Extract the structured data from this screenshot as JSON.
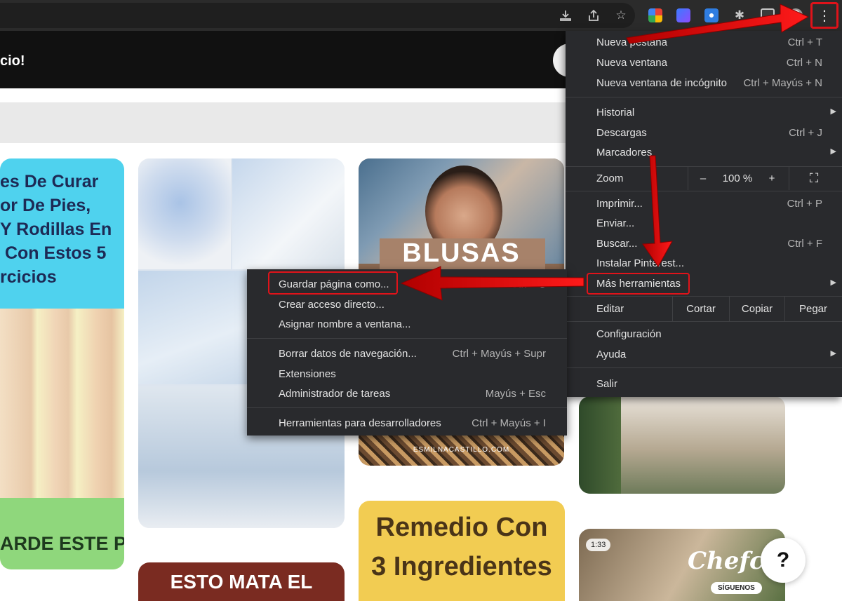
{
  "page": {
    "banner_text": "cio!",
    "pins": {
      "legs": {
        "title": "es De Curar\nor De Pies,\nY Rodillas En\n Con Estos 5\nrcicios",
        "cta": "ARDE ESTE PIN"
      },
      "fashion": {
        "title": "BLUSAS",
        "url": "ESMILNACASTILLO.COM"
      },
      "sugar": {
        "title": "ESTO MATA EL"
      },
      "remedy": {
        "title": "Remedio Con\n3 Ingredientes"
      },
      "video": {
        "duration": "1:33",
        "brand": "Chefcl",
        "subscribe": "SÍGUENOS"
      }
    },
    "help_label": "?"
  },
  "toolbar": {
    "icons": [
      "download-icon",
      "share-icon",
      "bookmark-star-icon",
      "puzzle-extensions-icon",
      "profile-avatar"
    ],
    "menu_glyph": "⋮"
  },
  "menu": {
    "nueva_pestana": {
      "label": "Nueva pestaña",
      "shortcut": "Ctrl + T"
    },
    "nueva_ventana": {
      "label": "Nueva ventana",
      "shortcut": "Ctrl + N"
    },
    "incognito": {
      "label": "Nueva ventana de incógnito",
      "shortcut": "Ctrl + Mayús + N"
    },
    "historial": {
      "label": "Historial"
    },
    "descargas": {
      "label": "Descargas",
      "shortcut": "Ctrl + J"
    },
    "marcadores": {
      "label": "Marcadores"
    },
    "zoom": {
      "label": "Zoom",
      "minus": "–",
      "value": "100 %",
      "plus": "+",
      "fullscreen": "⛶"
    },
    "imprimir": {
      "label": "Imprimir...",
      "shortcut": "Ctrl + P"
    },
    "enviar": {
      "label": "Enviar..."
    },
    "buscar": {
      "label": "Buscar...",
      "shortcut": "Ctrl + F"
    },
    "instalar": {
      "label": "Instalar Pinterest..."
    },
    "mas_herramientas": {
      "label": "Más herramientas"
    },
    "editar": {
      "label": "Editar",
      "cortar": "Cortar",
      "copiar": "Copiar",
      "pegar": "Pegar"
    },
    "configuracion": {
      "label": "Configuración"
    },
    "ayuda": {
      "label": "Ayuda"
    },
    "salir": {
      "label": "Salir"
    }
  },
  "submenu": {
    "guardar": {
      "label": "Guardar página como...",
      "shortcut": "Ctrl + S"
    },
    "acceso": {
      "label": "Crear acceso directo..."
    },
    "asignar": {
      "label": "Asignar nombre a ventana..."
    },
    "borrar": {
      "label": "Borrar datos de navegación...",
      "shortcut": "Ctrl + Mayús + Supr"
    },
    "extensiones": {
      "label": "Extensiones"
    },
    "tareas": {
      "label": "Administrador de tareas",
      "shortcut": "Mayús + Esc"
    },
    "devtools": {
      "label": "Herramientas para desarrolladores",
      "shortcut": "Ctrl + Mayús + I"
    }
  },
  "colors": {
    "toolbar": "#2b2b2b",
    "menu_bg": "#292a2d",
    "highlight_red": "#e0131a",
    "banner": "#111111"
  }
}
